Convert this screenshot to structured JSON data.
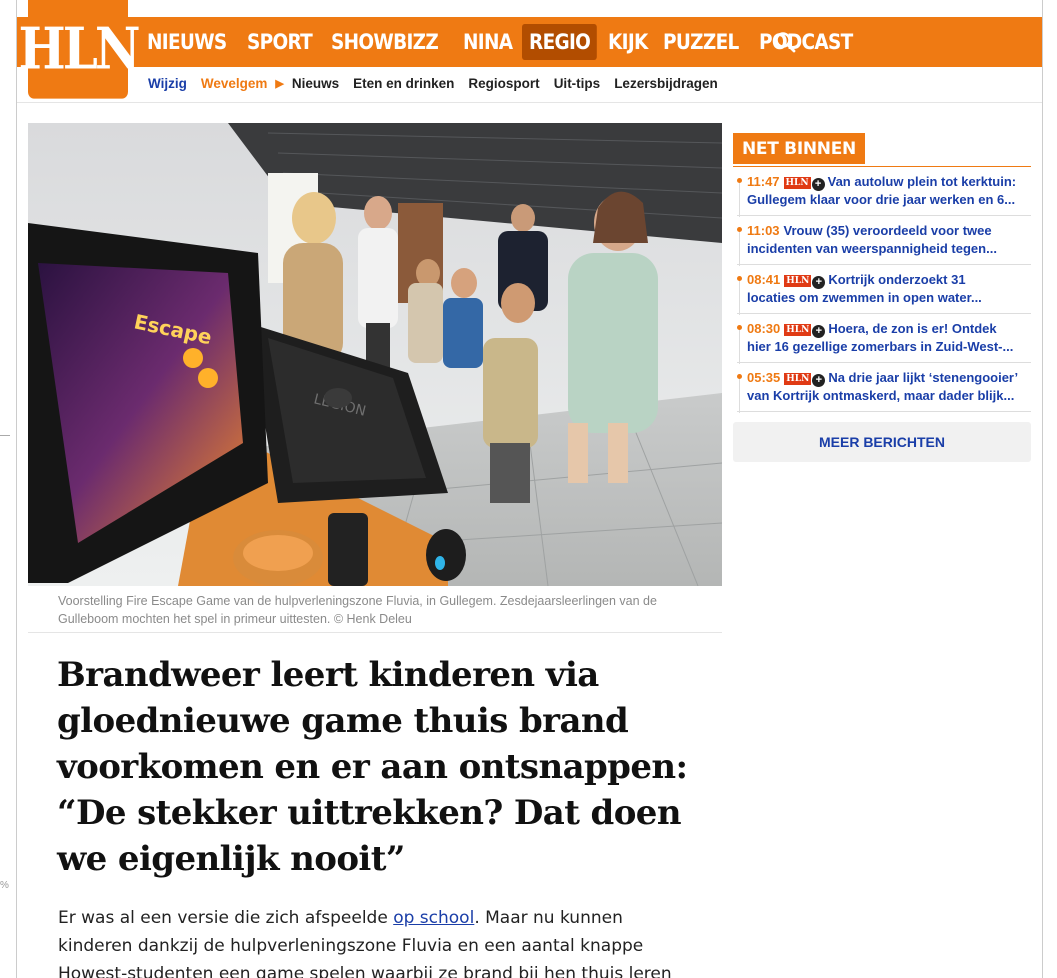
{
  "brand": {
    "logo_text": "HLN",
    "accent": "#ef7a13",
    "link": "#1a3ea8"
  },
  "nav": {
    "items": [
      {
        "label": "NIEUWS",
        "active": false
      },
      {
        "label": "SPORT",
        "active": false
      },
      {
        "label": "SHOWBIZZ",
        "active": false
      },
      {
        "label": "NINA",
        "active": false
      },
      {
        "label": "REGIO",
        "active": true
      },
      {
        "label": "KIJK",
        "active": false
      },
      {
        "label": "PUZZEL",
        "active": false
      },
      {
        "label": "PODCAST",
        "active": false
      }
    ],
    "search_icon": "search-icon"
  },
  "subnav": {
    "wijzig": "Wijzig",
    "region": "Wevelgem",
    "items": [
      "Nieuws",
      "Eten en drinken",
      "Regiosport",
      "Uit-tips",
      "Lezersbijdragen"
    ]
  },
  "article": {
    "caption": "Voorstelling Fire Escape Game van de hulpverleningszone Fluvia, in Gullegem. Zesdejaarsleerlingen van de Gulleboom mochten het spel in primeur uittesten. © Henk Deleu",
    "screen_text": "Escape",
    "case_text": "LEGION",
    "headline": "Brandweer leert kinderen via gloednieuwe game thuis brand voorkomen en er aan ontsnappen: “De stekker uittrekken? Dat doen we eigenlijk nooit”",
    "lead_before": "Er was al een versie die zich afspeelde ",
    "lead_link": "op school",
    "lead_after": ". Maar nu kunnen kinderen dankzij de hulpverleningszone Fluvia en een aantal knappe Howest-studenten een game spelen waarbij ze brand bij hen thuis leren"
  },
  "sidebar": {
    "heading": "NET BINNEN",
    "badge": "HLN",
    "plus": "+",
    "items": [
      {
        "time": "11:47",
        "premium": true,
        "line1": "Van autoluw plein tot kerktuin:",
        "line2": "Gullegem klaar voor drie jaar werken en 6..."
      },
      {
        "time": "11:03",
        "premium": false,
        "line1": "Vrouw (35) veroordeeld voor twee",
        "line2": "incidenten van weerspannigheid tegen..."
      },
      {
        "time": "08:41",
        "premium": true,
        "line1": "Kortrijk onderzoekt 31",
        "line2": "locaties om zwemmen in open water..."
      },
      {
        "time": "08:30",
        "premium": true,
        "line1": "Hoera, de zon is er! Ontdek",
        "line2": "hier 16 gezellige zomerbars in Zuid-West-..."
      },
      {
        "time": "05:35",
        "premium": true,
        "line1": "Na drie jaar lijkt ‘stenengooier’",
        "line2": "van Kortrijk ontmaskerd, maar dader blijk..."
      }
    ],
    "more_label": "MEER BERICHTEN"
  },
  "margin_mark": "%"
}
